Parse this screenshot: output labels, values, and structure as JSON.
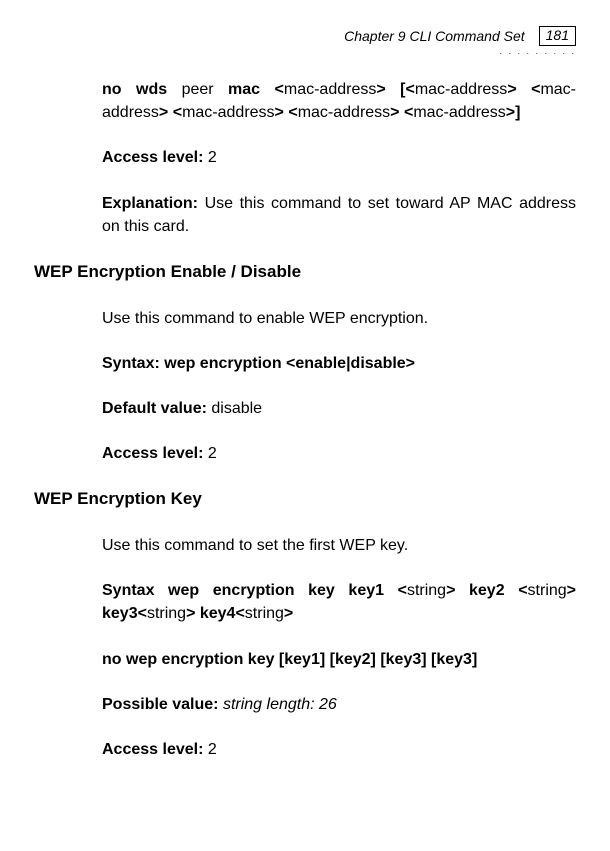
{
  "header": {
    "chapter": "Chapter 9 CLI Command Set",
    "page_number": "181",
    "dots": ". . . . . . . . ."
  },
  "s1": {
    "syntax_b1": "no wds",
    "syntax_t1": " peer ",
    "syntax_b2": "mac <",
    "syntax_t2": "mac-address",
    "syntax_b3": "> [<",
    "syntax_t3": "mac-address",
    "syntax_b4": "> <",
    "syntax_t4": "mac-address",
    "syntax_b5": "> <",
    "syntax_t5": "mac-address",
    "syntax_b6": "> <",
    "syntax_t6": "mac-address",
    "syntax_b7": "> <",
    "syntax_t7": "mac-address",
    "syntax_b8": ">]",
    "access_label": "Access level: ",
    "access_value": "2",
    "expl_label": "Explanation: ",
    "expl_text": "Use this command to set toward AP MAC address on this card."
  },
  "s2": {
    "heading": "WEP Encryption Enable / Disable",
    "desc": "Use this command to enable WEP encryption.",
    "syntax": "Syntax: wep encryption <enable|disable>",
    "default_label": "Default value: ",
    "default_value": "disable",
    "access_label": "Access level: ",
    "access_value": "2"
  },
  "s3": {
    "heading": "WEP Encryption Key",
    "desc": "Use this command to set the first WEP key.",
    "syn_b1": "Syntax wep encryption key key1 <",
    "syn_t1": "string",
    "syn_b2": "> key2 <",
    "syn_t2": "string",
    "syn_b3": "> key3<",
    "syn_t3": "string",
    "syn_b4": "> key4<",
    "syn_t4": "string",
    "syn_b5": ">",
    "no_syntax": "no wep encryption key [key1] [key2] [key3] [key3]",
    "pv_label": "Possible value: ",
    "pv_value": "string length: 26",
    "access_label": "Access level: ",
    "access_value": "2"
  }
}
